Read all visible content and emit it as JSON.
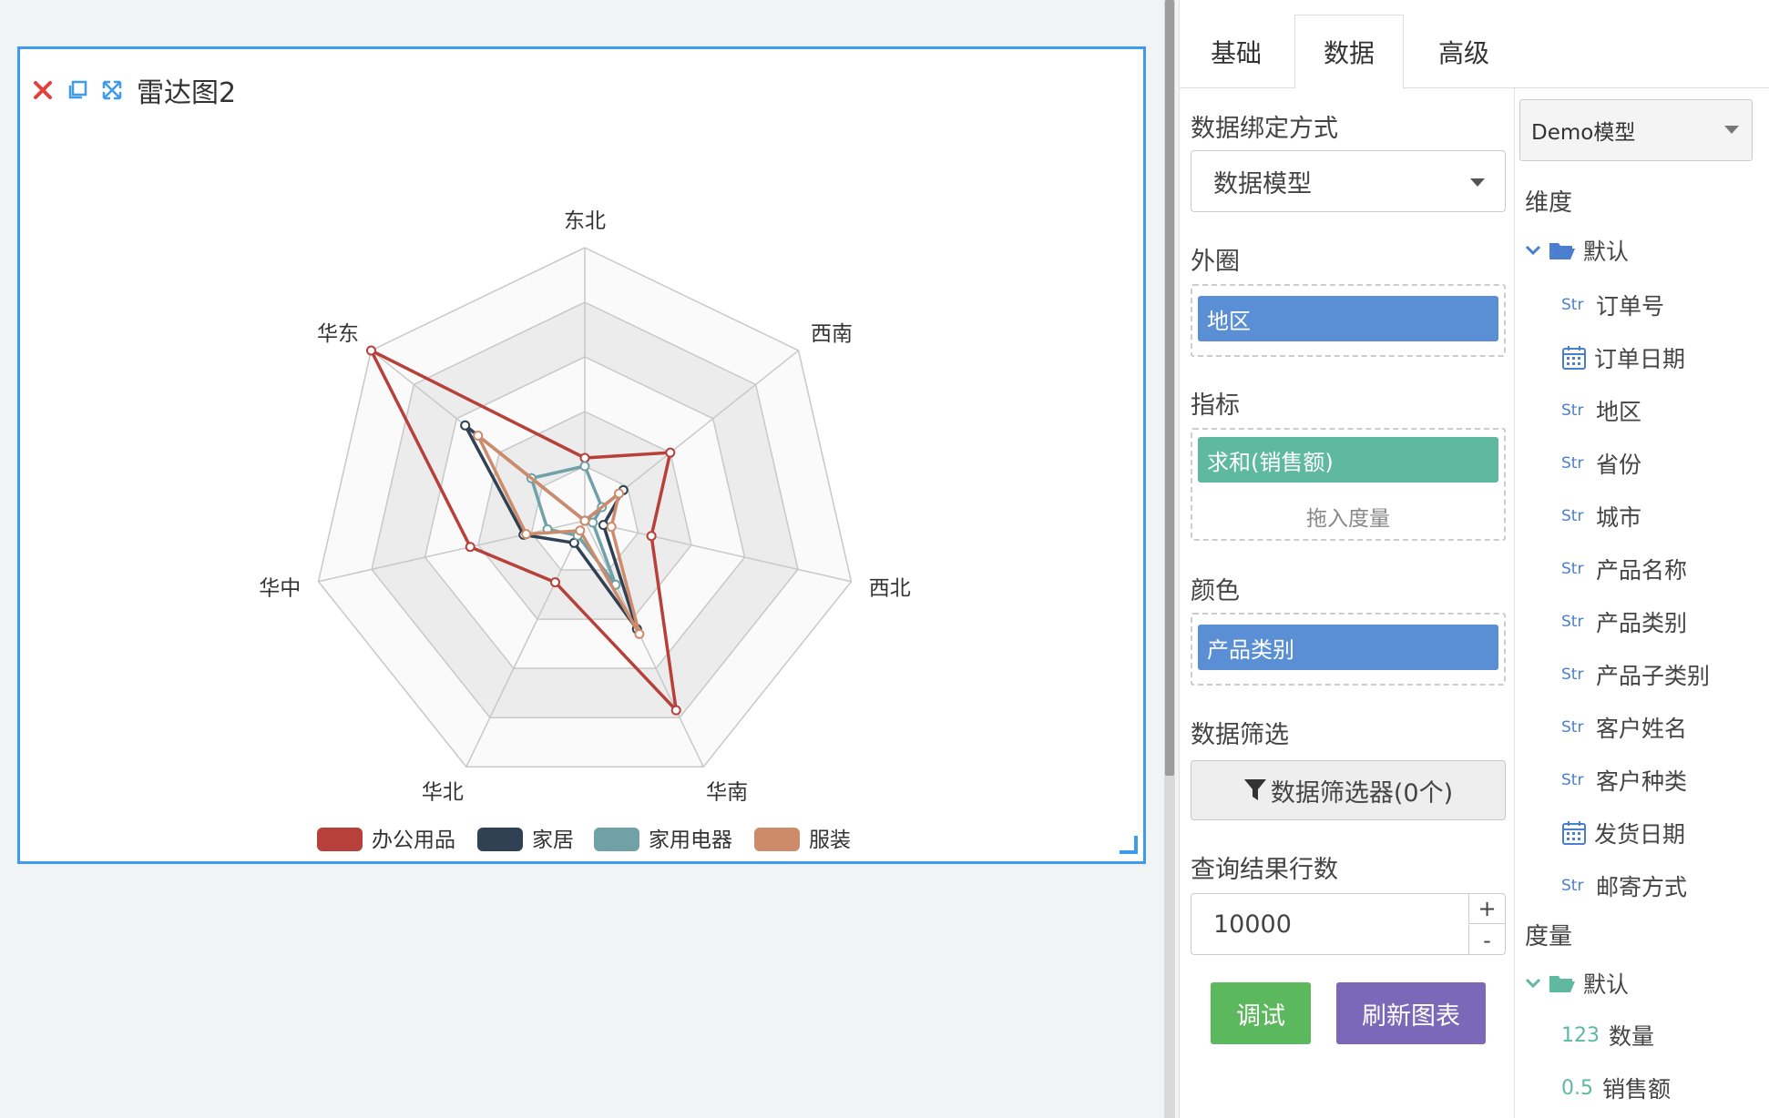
{
  "widget": {
    "title": "雷达图2"
  },
  "colors": {
    "office": "#b8403a",
    "home": "#2f4152",
    "appliance": "#6fa1a6",
    "apparel": "#ce8b6c",
    "accent": "#3e9bf0"
  },
  "chart_data": {
    "type": "radar",
    "indicators": [
      "东北",
      "西南",
      "西北",
      "华南",
      "华北",
      "华中",
      "华东"
    ],
    "rmax": 1,
    "series": [
      {
        "name": "办公用品",
        "values": [
          0.23,
          0.4,
          0.25,
          0.77,
          0.25,
          0.43,
          1.0
        ]
      },
      {
        "name": "家居",
        "values": [
          0.0,
          0.18,
          0.07,
          0.44,
          0.09,
          0.23,
          0.56
        ]
      },
      {
        "name": "家用电器",
        "values": [
          0.2,
          0.08,
          0.03,
          0.26,
          0.06,
          0.14,
          0.25
        ]
      },
      {
        "name": "服装",
        "values": [
          0.0,
          0.16,
          0.1,
          0.46,
          0.04,
          0.22,
          0.5
        ]
      }
    ]
  },
  "tabs": [
    {
      "label": "基础"
    },
    {
      "label": "数据"
    },
    {
      "label": "高级"
    }
  ],
  "config": {
    "binding_label": "数据绑定方式",
    "binding_value": "数据模型",
    "outer_label": "外圈",
    "outer_field": "地区",
    "metric_label": "指标",
    "metric_field": "求和(销售额)",
    "metric_placeholder": "拖入度量",
    "color_label": "颜色",
    "color_field": "产品类别",
    "filter_label": "数据筛选",
    "filter_button": "数据筛选器(0个)",
    "rows_label": "查询结果行数",
    "rows_value": "10000",
    "plus": "+",
    "minus": "-",
    "debug_button": "调试",
    "refresh_button": "刷新图表"
  },
  "model": {
    "selected": "Demo模型",
    "dimension_label": "维度",
    "dimension_folder": "默认",
    "dimensions": [
      {
        "type": "Str",
        "label": "订单号"
      },
      {
        "type": "date",
        "label": "订单日期"
      },
      {
        "type": "Str",
        "label": "地区"
      },
      {
        "type": "Str",
        "label": "省份"
      },
      {
        "type": "Str",
        "label": "城市"
      },
      {
        "type": "Str",
        "label": "产品名称"
      },
      {
        "type": "Str",
        "label": "产品类别"
      },
      {
        "type": "Str",
        "label": "产品子类别"
      },
      {
        "type": "Str",
        "label": "客户姓名"
      },
      {
        "type": "Str",
        "label": "客户种类"
      },
      {
        "type": "date",
        "label": "发货日期"
      },
      {
        "type": "Str",
        "label": "邮寄方式"
      }
    ],
    "measure_label": "度量",
    "measure_folder": "默认",
    "measures": [
      {
        "type": "123",
        "label": "数量"
      },
      {
        "type": "0.5",
        "label": "销售额"
      }
    ]
  }
}
